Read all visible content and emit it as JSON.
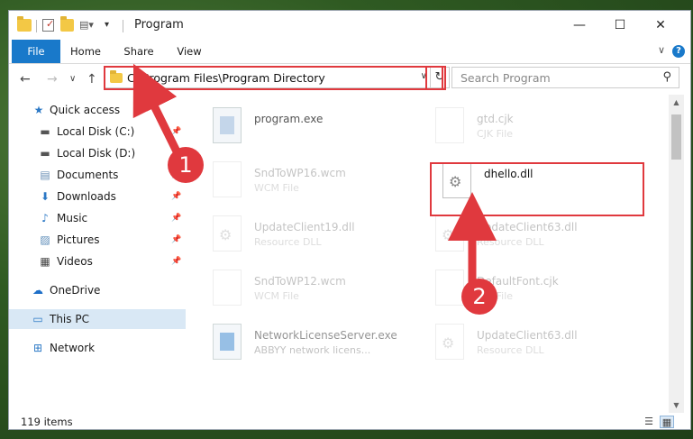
{
  "window": {
    "title": "Program",
    "minimize": "—",
    "maximize": "☐",
    "close": "✕"
  },
  "ribbon": {
    "tabs": [
      "File",
      "Home",
      "Share",
      "View"
    ],
    "help": "?",
    "collapse": "∨"
  },
  "navigation": {
    "back": "←",
    "forward": "→",
    "recent": "∨",
    "up": "↑",
    "address_path": "C:\\Program Files\\Program Directory",
    "address_dropdown": "∨",
    "refresh": "↻",
    "search_placeholder": "Search Program",
    "search_icon": "⚲"
  },
  "sidebar": {
    "items": [
      {
        "label": "Quick access",
        "icon": "star-icon",
        "glyph": "★"
      },
      {
        "label": "Local Disk (C:)",
        "icon": "drive-icon",
        "glyph": "▬"
      },
      {
        "label": "Local Disk (D:)",
        "icon": "drive-icon",
        "glyph": "▬"
      },
      {
        "label": "Documents",
        "icon": "documents-icon",
        "glyph": "▤"
      },
      {
        "label": "Downloads",
        "icon": "download-icon",
        "glyph": "⬇"
      },
      {
        "label": "Music",
        "icon": "music-icon",
        "glyph": "♪"
      },
      {
        "label": "Pictures",
        "icon": "pictures-icon",
        "glyph": "▨"
      },
      {
        "label": "Videos",
        "icon": "videos-icon",
        "glyph": "▦"
      },
      {
        "label": "OneDrive",
        "icon": "cloud-icon",
        "glyph": "☁"
      },
      {
        "label": "This PC",
        "icon": "computer-icon",
        "glyph": "▭"
      },
      {
        "label": "Network",
        "icon": "network-icon",
        "glyph": "⊞"
      }
    ],
    "pin_glyph": "📌"
  },
  "files": [
    {
      "name": "program.exe",
      "type": ""
    },
    {
      "name": "gtd.cjk",
      "type": "CJK File"
    },
    {
      "name": "SndToWP16.wcm",
      "type": "WCM File"
    },
    {
      "name": "dhello.dll",
      "type": ""
    },
    {
      "name": "UpdateClient19.dll",
      "type": "Resource DLL"
    },
    {
      "name": "UpdateClient63.dll",
      "type": "Resource DLL"
    },
    {
      "name": "SndToWP12.wcm",
      "type": "WCM File"
    },
    {
      "name": "DefaultFont.cjk",
      "type": "CJK File"
    },
    {
      "name": "NetworkLicenseServer.exe",
      "type": "ABBYY network licens..."
    },
    {
      "name": "UpdateClient63.dll",
      "type": "Resource DLL"
    }
  ],
  "status": {
    "item_count": "119 items"
  },
  "callouts": [
    "1",
    "2"
  ],
  "colors": {
    "accent": "#1979ca",
    "highlight": "#e0393e",
    "selection": "#d9e8f5"
  }
}
